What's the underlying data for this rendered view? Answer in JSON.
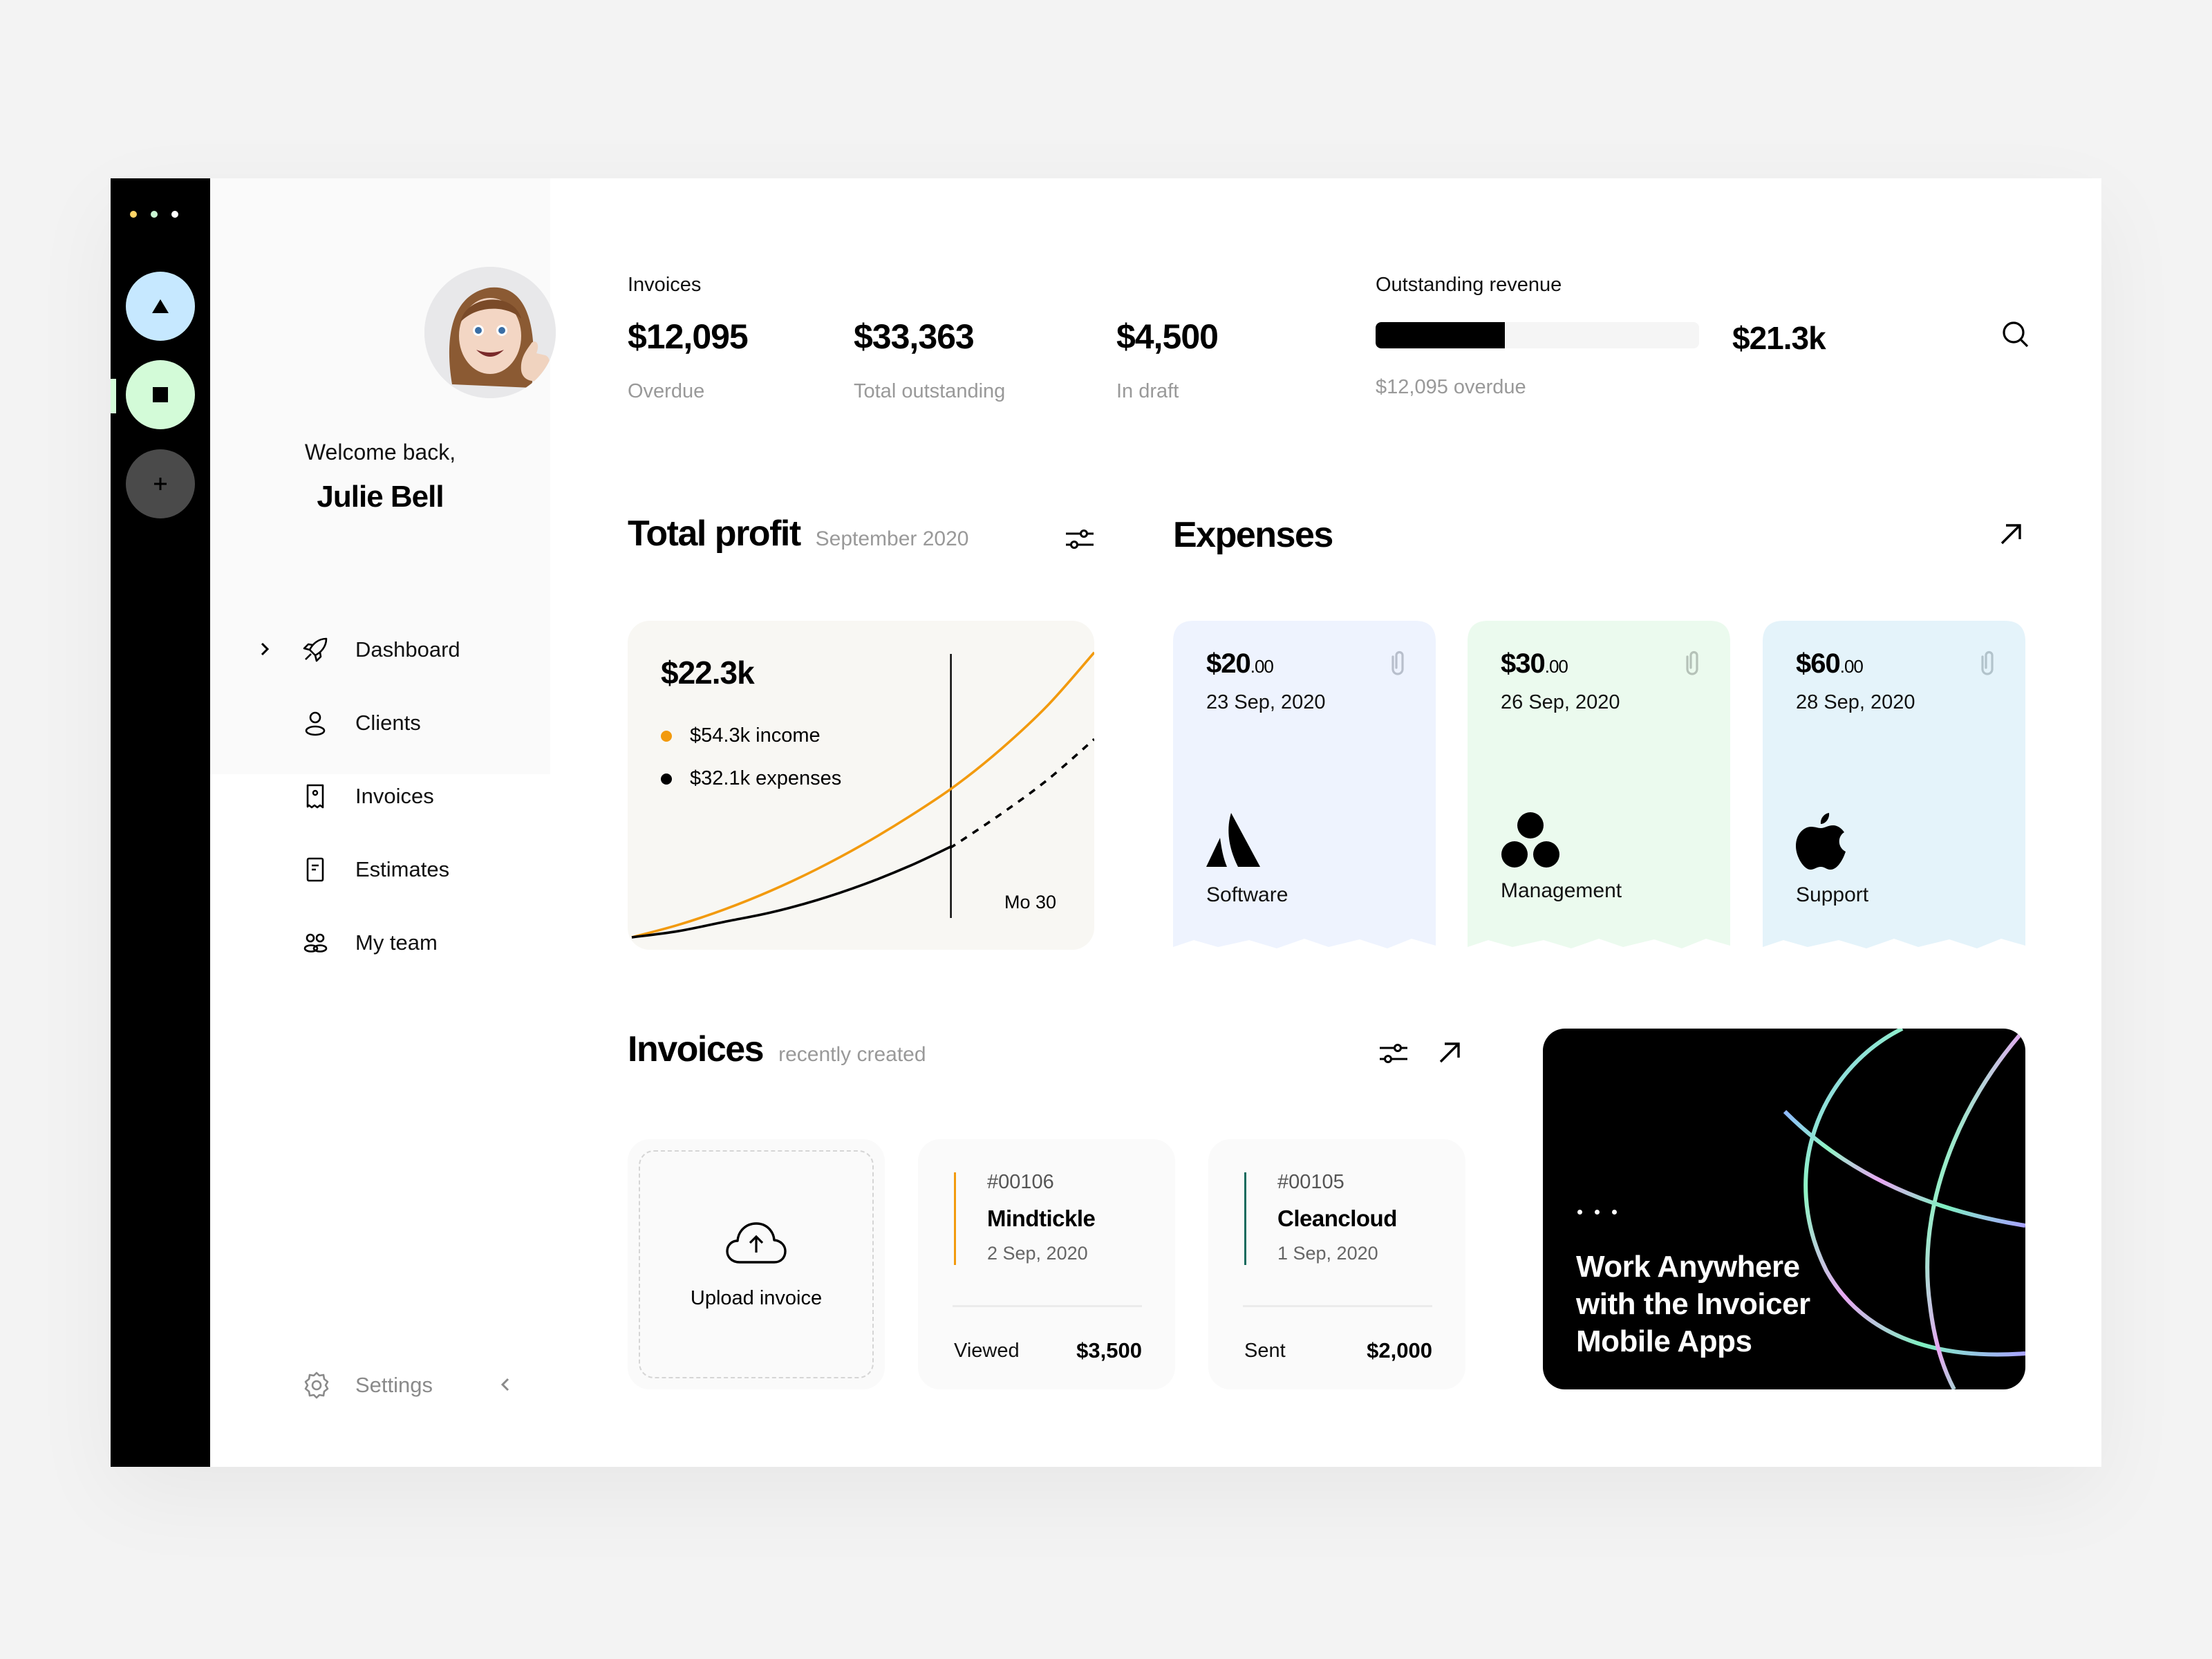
{
  "rail": {
    "window_dots": [
      "#ffd466",
      "#c9f7d3",
      "#ffffff"
    ],
    "apps": [
      {
        "name": "triangle-app",
        "color": "#c6e8ff",
        "active": false
      },
      {
        "name": "square-app",
        "color": "#d3fbd8",
        "active": true
      },
      {
        "name": "add-app",
        "color": "#4a4a4a",
        "active": false
      }
    ]
  },
  "sidebar": {
    "welcome": "Welcome back,",
    "user_name": "Julie Bell",
    "nav": [
      {
        "label": "Dashboard",
        "icon": "rocket-icon",
        "active": true
      },
      {
        "label": "Clients",
        "icon": "user-icon",
        "active": false
      },
      {
        "label": "Invoices",
        "icon": "receipt-icon",
        "active": false
      },
      {
        "label": "Estimates",
        "icon": "document-icon",
        "active": false
      },
      {
        "label": "My team",
        "icon": "team-icon",
        "active": false
      }
    ],
    "settings_label": "Settings"
  },
  "summary": {
    "invoices_label": "Invoices",
    "stats": [
      {
        "value": "$12,095",
        "label": "Overdue"
      },
      {
        "value": "$33,363",
        "label": "Total outstanding"
      },
      {
        "value": "$4,500",
        "label": "In draft"
      }
    ],
    "outstanding": {
      "label": "Outstanding revenue",
      "value": "$21.3k",
      "progress_fraction": 0.4,
      "sub": "$12,095 overdue"
    }
  },
  "profit": {
    "title": "Total profit",
    "period": "September 2020",
    "total": "$22.3k",
    "legend": [
      {
        "label": "$54.3k income",
        "color": "#f29a0e"
      },
      {
        "label": "$32.1k expenses",
        "color": "#000000"
      }
    ],
    "marker_label": "Mo 30"
  },
  "chart_data": {
    "type": "line",
    "title": "Total profit",
    "subtitle": "September 2020",
    "xlabel": "",
    "ylabel": "",
    "x": [
      0,
      0.1,
      0.2,
      0.3,
      0.4,
      0.5,
      0.6,
      0.7,
      0.8,
      0.9,
      1.0
    ],
    "marker_x": 0.69,
    "marker_label": "Mo 30",
    "series": [
      {
        "name": "income",
        "color": "#f29a0e",
        "style": "solid",
        "values": [
          0,
          0.04,
          0.09,
          0.15,
          0.22,
          0.3,
          0.39,
          0.49,
          0.61,
          0.75,
          0.92
        ]
      },
      {
        "name": "expenses",
        "color": "#000000",
        "style": "solid-then-dashed",
        "dashed_from": 0.69,
        "values": [
          0,
          0.02,
          0.05,
          0.08,
          0.12,
          0.17,
          0.23,
          0.3,
          0.4,
          0.51,
          0.64
        ]
      }
    ],
    "ylim": [
      0,
      1
    ],
    "grid": false,
    "legend": "top-left"
  },
  "expenses": {
    "title": "Expenses",
    "cards": [
      {
        "amount": "$20",
        "cents": ".00",
        "date": "23 Sep, 2020",
        "category": "Software",
        "logo": "atlassian-logo-icon",
        "bg": "#eef3fe"
      },
      {
        "amount": "$30",
        "cents": ".00",
        "date": "26 Sep, 2020",
        "category": "Management",
        "logo": "asana-logo-icon",
        "bg": "#ebfaee"
      },
      {
        "amount": "$60",
        "cents": ".00",
        "date": "28 Sep, 2020",
        "category": "Support",
        "logo": "apple-logo-icon",
        "bg": "#e4f3fa"
      }
    ]
  },
  "invoices": {
    "title": "Invoices",
    "subtitle": "recently created",
    "upload_label": "Upload invoice",
    "items": [
      {
        "number": "#00106",
        "client": "Mindtickle",
        "date": "2 Sep, 2020",
        "status": "Viewed",
        "amount": "$3,500",
        "accent": "#f29a0e"
      },
      {
        "number": "#00105",
        "client": "Cleancloud",
        "date": "1 Sep, 2020",
        "status": "Sent",
        "amount": "$2,000",
        "accent": "#136b5e"
      }
    ]
  },
  "promo": {
    "title": "Work Anywhere with the Invoicer Mobile Apps"
  }
}
